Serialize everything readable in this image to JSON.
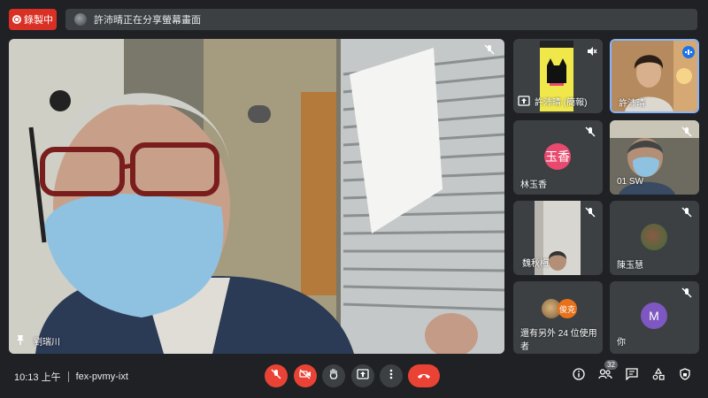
{
  "recording": {
    "label": "錄製中",
    "color": "#d93025"
  },
  "banner": {
    "text": "許沛晴正在分享螢幕畫面"
  },
  "main_speaker": {
    "name": "劉瑞川",
    "icon": "push-pin-icon"
  },
  "tiles": [
    {
      "name": "許沛晴 (簡報)",
      "icon": "present-screen-icon"
    },
    {
      "name": "許沛晴",
      "speaking": true,
      "accent": "#1a73e8"
    },
    {
      "name": "林玉香",
      "avatar_text": "玉香",
      "avatar_color": "#e84a6f"
    },
    {
      "name": "01 SW"
    },
    {
      "name": "魏秋梅"
    },
    {
      "name": "陳玉慧"
    },
    {
      "name": "還有另外 24 位使用者",
      "avatar_text": "俊克",
      "avatar_color": "#e8711a"
    },
    {
      "name": "你",
      "avatar_text": "M",
      "avatar_color": "#7e57c2"
    }
  ],
  "meeting": {
    "time": "10:13 上午",
    "code": "fex-pvmy-ixt"
  },
  "participants_count": "32",
  "colors": {
    "danger": "#ea4335",
    "surface": "#3c4043",
    "background": "#202124"
  }
}
